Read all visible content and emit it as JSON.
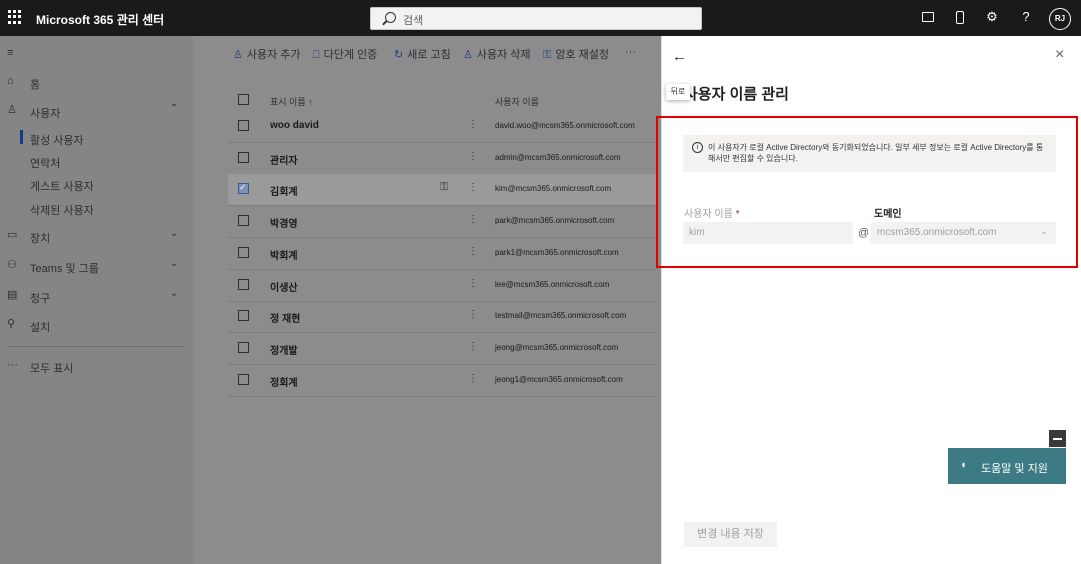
{
  "topbar": {
    "app_title": "Microsoft 365 관리 센터",
    "search_placeholder": "검색",
    "avatar_initials": "RJ"
  },
  "nav": {
    "home": "홈",
    "users": "사용자",
    "users_sub": [
      "활성 사용자",
      "연락처",
      "게스트 사용자",
      "삭제된 사용자"
    ],
    "devices": "장치",
    "teams_groups": "Teams 및 그룹",
    "billing": "청구",
    "setup": "설치",
    "show_all": "모두 표시"
  },
  "commands": {
    "add_user": "사용자 추가",
    "mfa": "다단계 인증",
    "refresh": "새로 고침",
    "delete_user": "사용자 삭제",
    "reset_password": "암호 재설정",
    "more": "···"
  },
  "table": {
    "col_display_name": "표시 이름 ↑",
    "col_username": "사용자 이름",
    "rows": [
      {
        "name": "woo david",
        "email": "david.woo@mcsm365.onmicrosoft.com",
        "selected": false
      },
      {
        "name": "관리자",
        "email": "admin@mcsm365.onmicrosoft.com",
        "selected": false
      },
      {
        "name": "김회계",
        "email": "kim@mcsm365.onmicrosoft.com",
        "selected": true
      },
      {
        "name": "박경영",
        "email": "park@mcsm365.onmicrosoft.com",
        "selected": false
      },
      {
        "name": "박회계",
        "email": "park1@mcsm365.onmicrosoft.com",
        "selected": false
      },
      {
        "name": "이생산",
        "email": "lee@mcsm365.onmicrosoft.com",
        "selected": false
      },
      {
        "name": "정 재현",
        "email": "testmail@mcsm365.onmicrosoft.com",
        "selected": false
      },
      {
        "name": "정개발",
        "email": "jeong@mcsm365.onmicrosoft.com",
        "selected": false
      },
      {
        "name": "정회계",
        "email": "jeong1@mcsm365.onmicrosoft.com",
        "selected": false
      }
    ]
  },
  "panel": {
    "back_tooltip": "뒤로",
    "title": "사용자 이름 관리",
    "info_text": "이 사용자가 로컬 Active Directory와 동기화되었습니다. 일부 세부 정보는 로컬 Active Directory를 통해서만 편집할 수 있습니다.",
    "username_label": "사용자 이름",
    "username_required": "*",
    "username_value": "kim",
    "at_sign": "@",
    "domain_label": "도메인",
    "domain_value": "mcsm365.onmicrosoft.com",
    "help_button": "도움말 및 지원",
    "save_button": "변경 내용 저장"
  },
  "colors": {
    "highlight_border": "#e00000",
    "help_button_bg": "#3c7a84",
    "topbar_bg": "#1b1a19"
  }
}
